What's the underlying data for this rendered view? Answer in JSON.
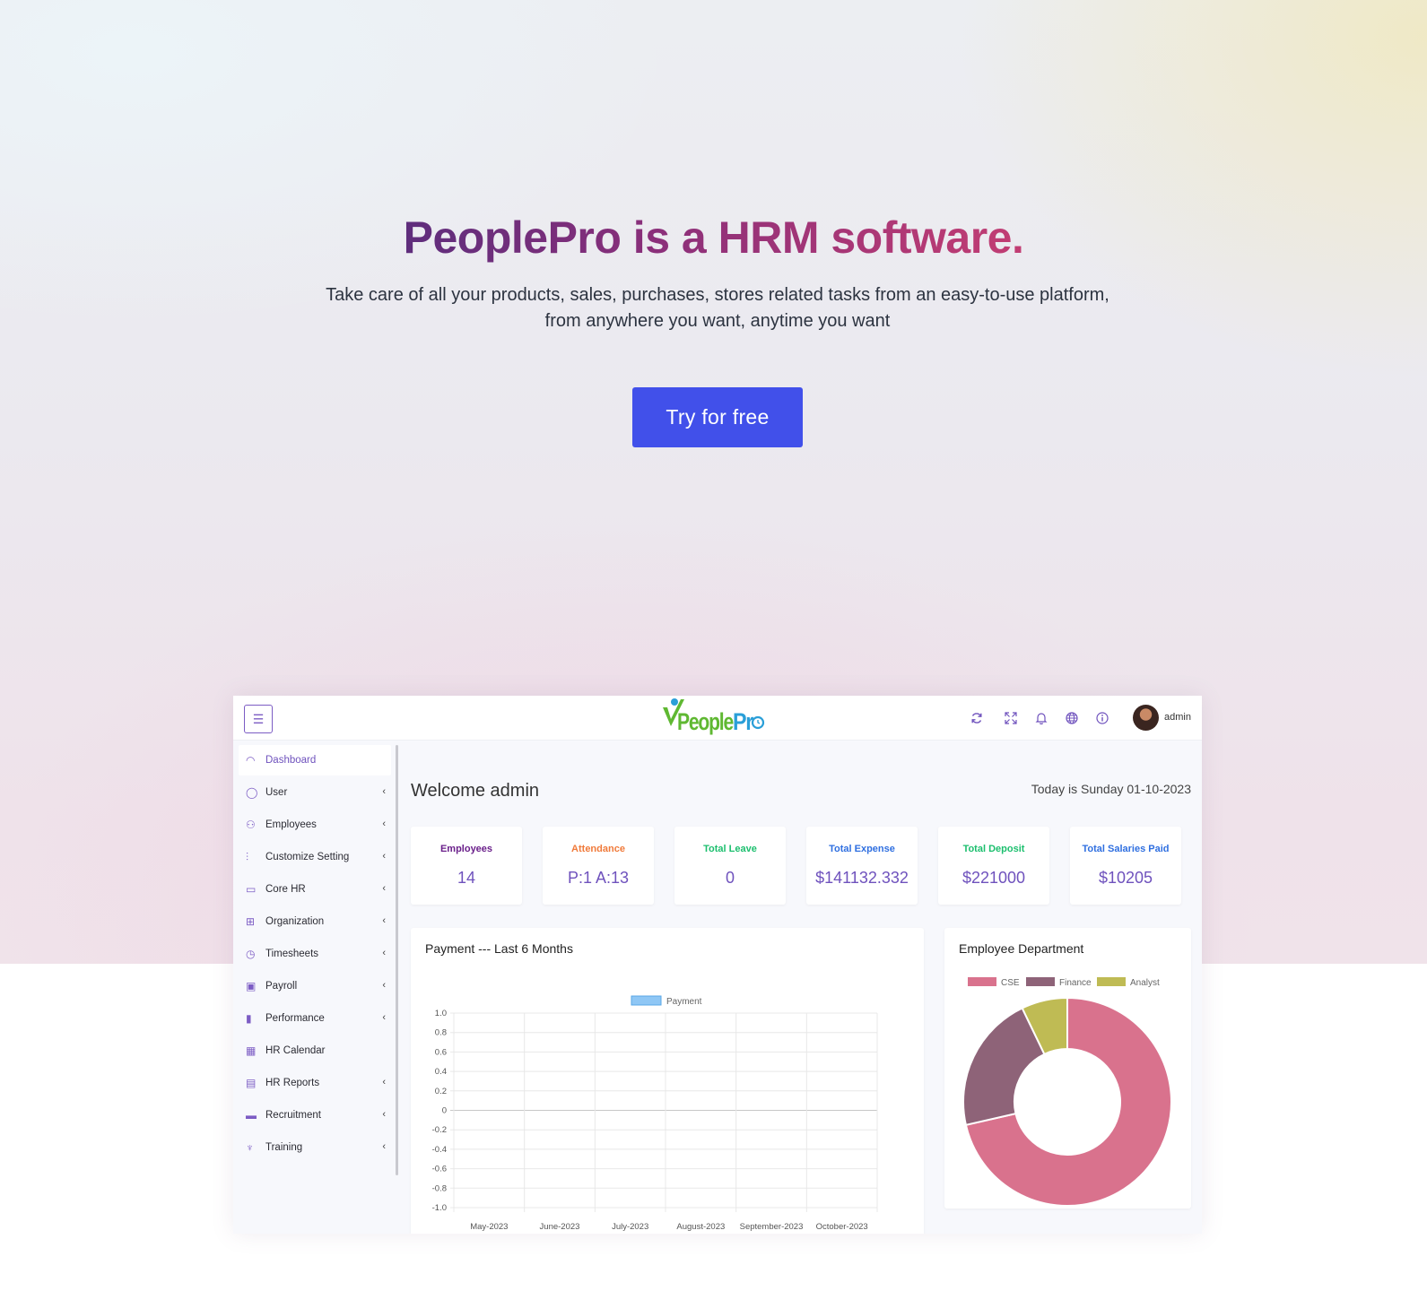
{
  "hero": {
    "headline": "PeoplePro is a HRM software.",
    "subtitle": "Take care of all your products, sales, purchases, stores related tasks from an easy-to-use platform, from anywhere you want, anytime you want",
    "cta_label": "Try for free",
    "cta_color": "#4150ea"
  },
  "app": {
    "logo_text": "PeoplePro",
    "topbar_icons": [
      "refresh-icon",
      "fullscreen-icon",
      "bell-icon",
      "globe-icon",
      "info-icon"
    ],
    "user_name": "admin",
    "sidebar": [
      {
        "label": "Dashboard",
        "icon": "dashboard-icon",
        "has_submenu": false,
        "active": true
      },
      {
        "label": "User",
        "icon": "user-icon",
        "has_submenu": true
      },
      {
        "label": "Employees",
        "icon": "employees-icon",
        "has_submenu": true
      },
      {
        "label": "Customize Setting",
        "icon": "sliders-icon",
        "has_submenu": true
      },
      {
        "label": "Core HR",
        "icon": "briefcase-icon",
        "has_submenu": true
      },
      {
        "label": "Organization",
        "icon": "grid-icon",
        "has_submenu": true
      },
      {
        "label": "Timesheets",
        "icon": "clock-icon",
        "has_submenu": true
      },
      {
        "label": "Payroll",
        "icon": "wallet-icon",
        "has_submenu": true
      },
      {
        "label": "Performance",
        "icon": "bar-chart-icon",
        "has_submenu": true
      },
      {
        "label": "HR Calendar",
        "icon": "calendar-icon",
        "has_submenu": false
      },
      {
        "label": "HR Reports",
        "icon": "report-icon",
        "has_submenu": true
      },
      {
        "label": "Recruitment",
        "icon": "id-card-icon",
        "has_submenu": true
      },
      {
        "label": "Training",
        "icon": "trophy-icon",
        "has_submenu": true
      }
    ],
    "welcome": "Welcome admin",
    "today": "Today is Sunday 01-10-2023",
    "stats": [
      {
        "label": "Employees",
        "value": "14",
        "color": "#6a1f8a"
      },
      {
        "label": "Attendance",
        "value": "P:1 A:13",
        "color": "#f07a3a"
      },
      {
        "label": "Total Leave",
        "value": "0",
        "color": "#1cbf6e"
      },
      {
        "label": "Total Expense",
        "value": "$141132.332",
        "color": "#2f6fe0"
      },
      {
        "label": "Total Deposit",
        "value": "$221000",
        "color": "#1cbf6e"
      },
      {
        "label": "Total Salaries Paid",
        "value": "$10205",
        "color": "#2f6fe0"
      }
    ],
    "payment_card_title": "Payment --- Last 6 Months",
    "department_card_title": "Employee Department"
  },
  "chart_data": [
    {
      "type": "line",
      "title": "Payment --- Last 6 Months",
      "categories": [
        "May-2023",
        "June-2023",
        "July-2023",
        "August-2023",
        "September-2023",
        "October-2023"
      ],
      "series": [
        {
          "name": "Payment",
          "values": [],
          "color": "#8fc7f5"
        }
      ],
      "yticks": [
        "1.0",
        "0.8",
        "0.6",
        "0.4",
        "0.2",
        "0",
        "-0.2",
        "-0.4",
        "-0.6",
        "-0.8",
        "-1.0"
      ],
      "ylim": [
        -1,
        1
      ],
      "grid": true,
      "legend": "top-center"
    },
    {
      "type": "pie",
      "title": "Employee Department",
      "labels": [
        "CSE",
        "Finance",
        "Analyst"
      ],
      "values": [
        10,
        3,
        1
      ],
      "colors": [
        "#d9728d",
        "#8e6378",
        "#bfbb54"
      ],
      "legend": "top-center"
    }
  ]
}
